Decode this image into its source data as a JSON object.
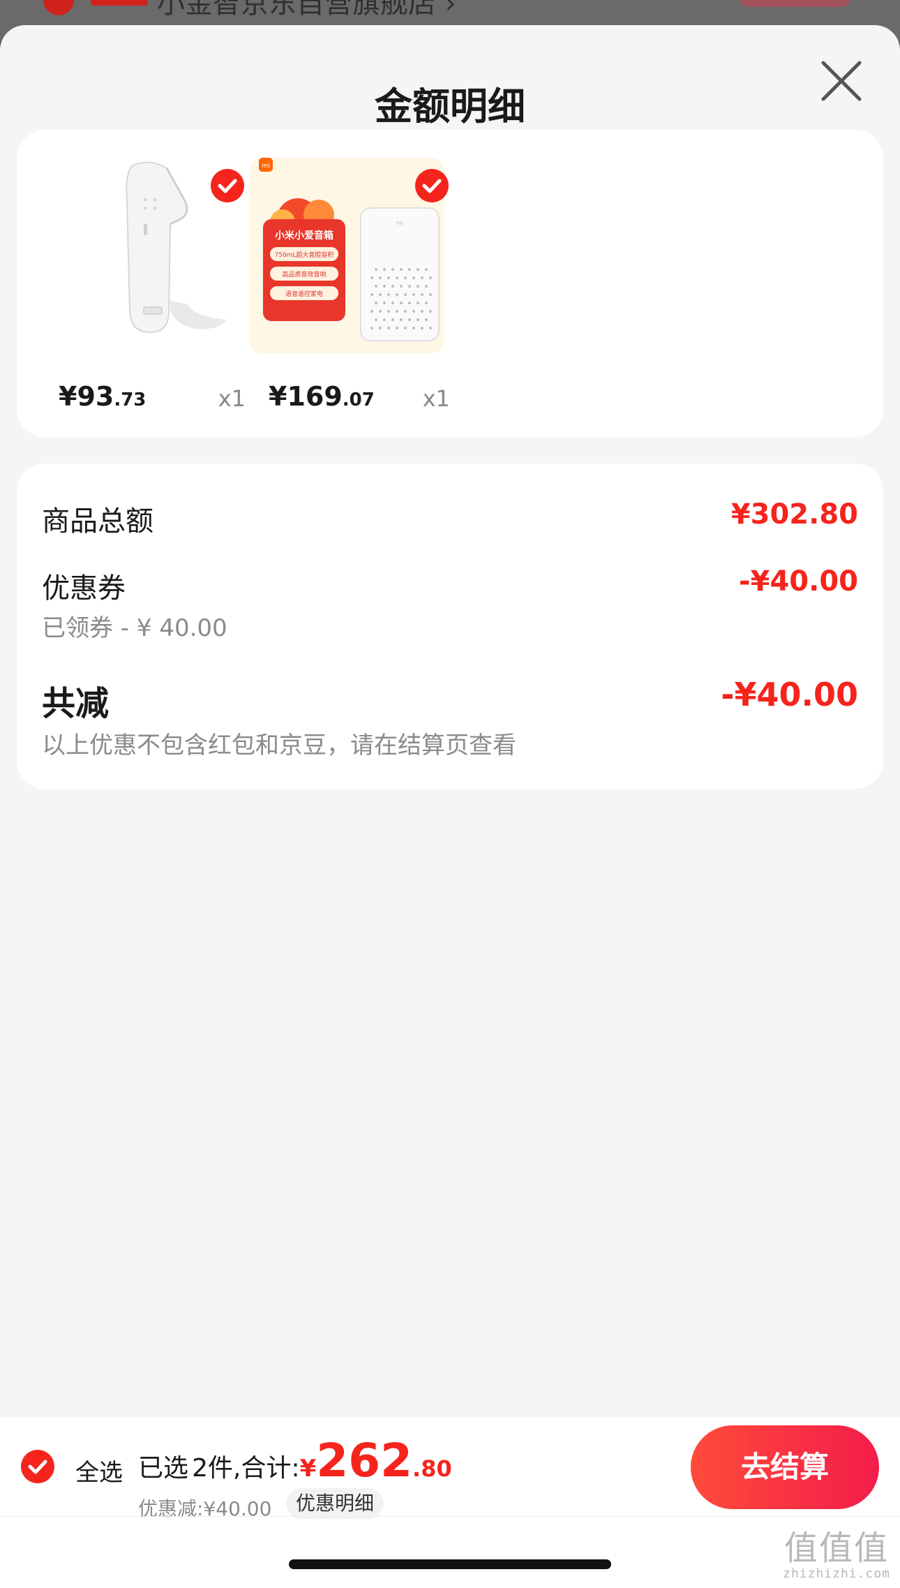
{
  "underlying": {
    "store_name": "小金智京东自营旗舰店 ›"
  },
  "sheet": {
    "title": "金额明细"
  },
  "products": [
    {
      "price_int": "¥93",
      "price_dec": ".73",
      "qty": "x1",
      "image_icon": "thermometer-image"
    },
    {
      "price_int": "¥169",
      "price_dec": ".07",
      "qty": "x1",
      "image_icon": "smart-speaker-image",
      "promo": {
        "brand": "mi",
        "title": "小米小爱音箱",
        "lines": [
          "750mL超大音腔容积",
          "高品质音效音响",
          "语音遥控家电"
        ]
      },
      "device_logo": "mi"
    }
  ],
  "summary": {
    "subtotal_label": "商品总额",
    "subtotal_value": "¥302.80",
    "coupon_label": "优惠券",
    "coupon_value": "-¥40.00",
    "coupon_detail": "已领券 - ¥ 40.00",
    "total_discount_label": "共减",
    "total_discount_value": "-¥40.00",
    "note": "以上优惠不包含红包和京豆，请在结算页查看"
  },
  "bottom": {
    "select_all": "全选",
    "selected_prefix": "已选",
    "selected_count": "2",
    "selected_suffix": "件,合计:",
    "currency": "¥",
    "total_int": "262",
    "total_dec": ".80",
    "discount_line": "优惠减:¥40.00",
    "detail_chip": "优惠明细",
    "checkout": "去结算"
  },
  "colors": {
    "accent_red": "#f5241d",
    "checkout_gradient": [
      "#ff4b3a",
      "#f31d4a"
    ]
  },
  "watermark": {
    "logo": "值值值",
    "site": "zhizhizhi.com"
  }
}
